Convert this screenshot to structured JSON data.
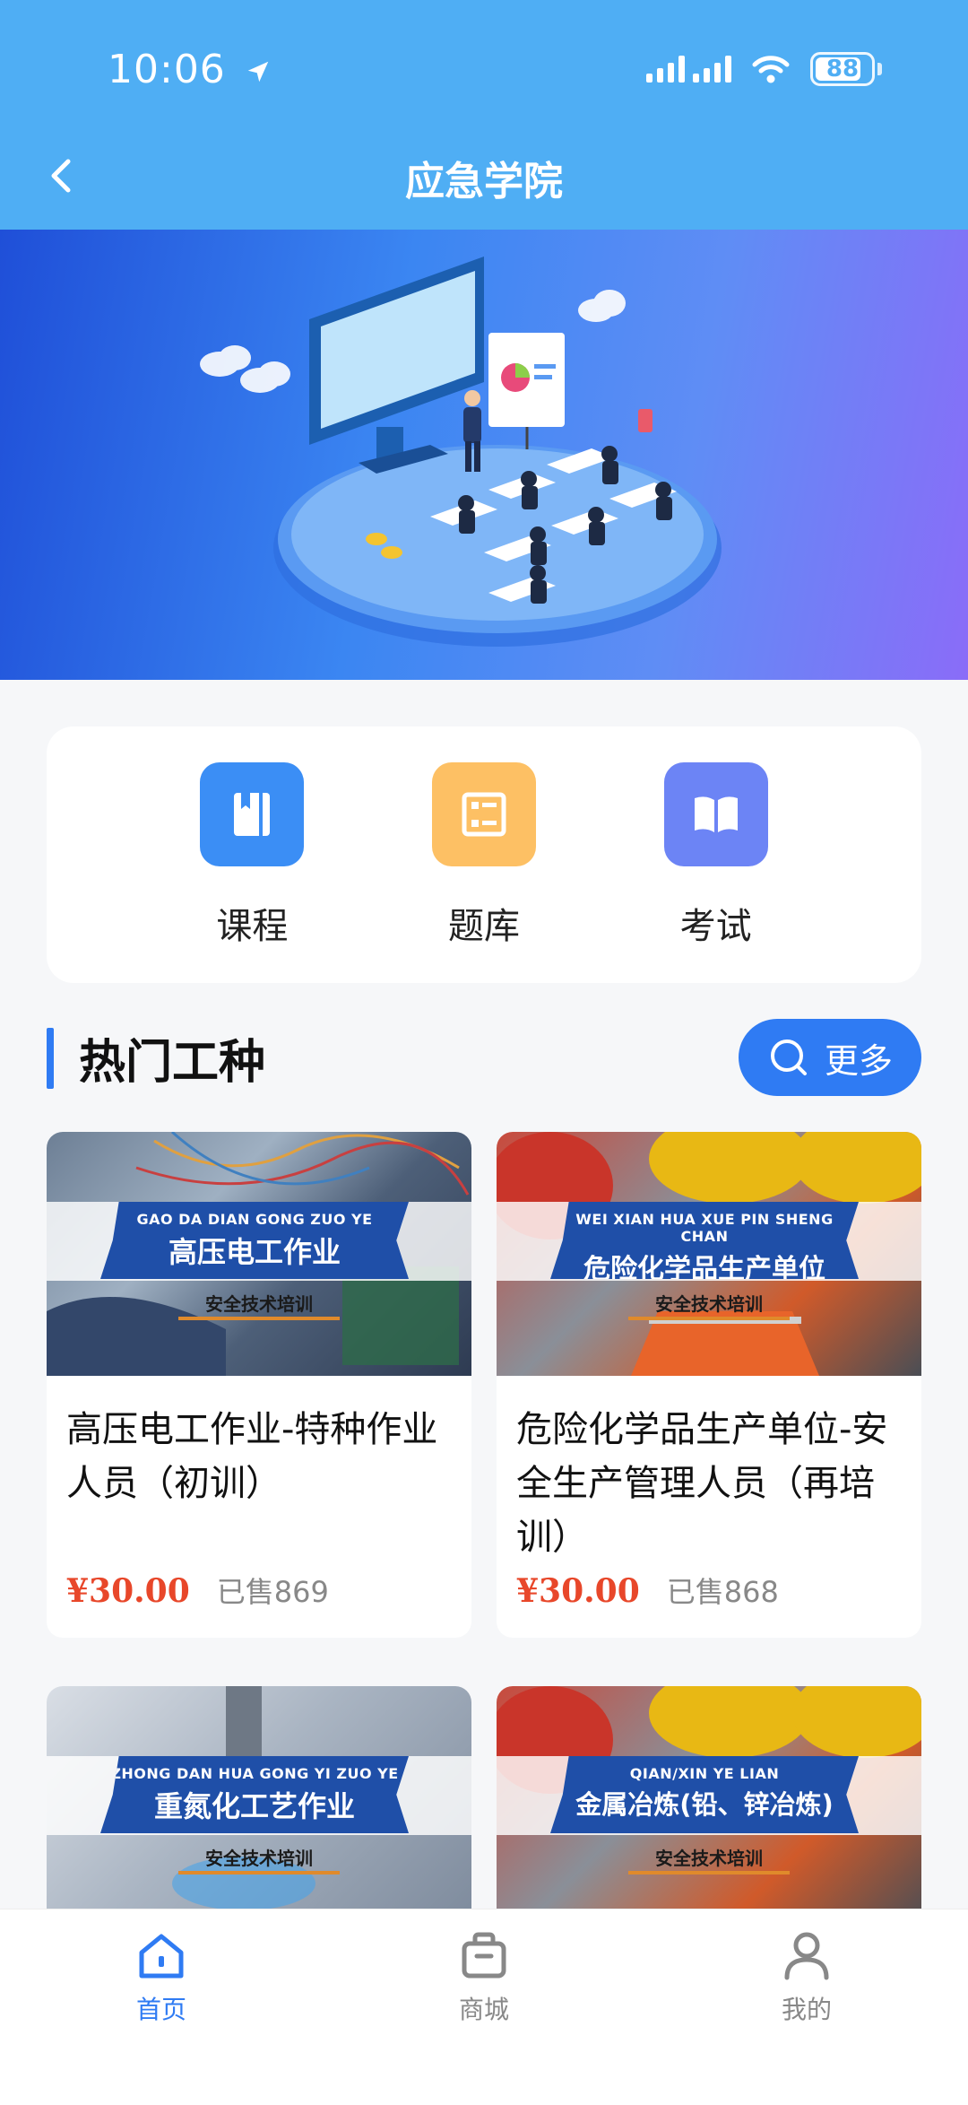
{
  "status_bar": {
    "time": "10:06",
    "battery": "88"
  },
  "header": {
    "title": "应急学院"
  },
  "quick_menu": [
    {
      "label": "课程",
      "icon": "book-icon",
      "color": "#3b8ef5"
    },
    {
      "label": "题库",
      "icon": "list-icon",
      "color": "#fdc064"
    },
    {
      "label": "考试",
      "icon": "open-book-icon",
      "color": "#6c84f5"
    }
  ],
  "section": {
    "title": "热门工种",
    "more_label": "更多"
  },
  "products": [
    {
      "banner_pinyin": "GAO DA DIAN GONG ZUO YE",
      "banner_title": "高压电工作业",
      "banner_sub": "安全技术培训",
      "title": "高压电工作业-特种作业人员（初训）",
      "price": "¥30.00",
      "sold": "已售869"
    },
    {
      "banner_pinyin": "WEI XIAN HUA XUE PIN SHENG CHAN",
      "banner_title": "危险化学品生产单位",
      "banner_sub": "安全技术培训",
      "title": "危险化学品生产单位-安全生产管理人员（再培训）",
      "price": "¥30.00",
      "sold": "已售868"
    },
    {
      "banner_pinyin": "ZHONG DAN HUA GONG YI ZUO YE",
      "banner_title": "重氮化工艺作业",
      "banner_sub": "安全技术培训"
    },
    {
      "banner_pinyin": "QIAN/XIN YE LIAN",
      "banner_title": "金属冶炼(铅、锌冶炼)",
      "banner_sub": "安全技术培训"
    }
  ],
  "tabbar": [
    {
      "label": "首页",
      "icon": "home-icon",
      "active": true
    },
    {
      "label": "商城",
      "icon": "shopping-bag-icon",
      "active": false
    },
    {
      "label": "我的",
      "icon": "user-icon",
      "active": false
    }
  ],
  "colors": {
    "header": "#4faef4",
    "accent": "#2f7bf3",
    "price": "#e8472a"
  }
}
